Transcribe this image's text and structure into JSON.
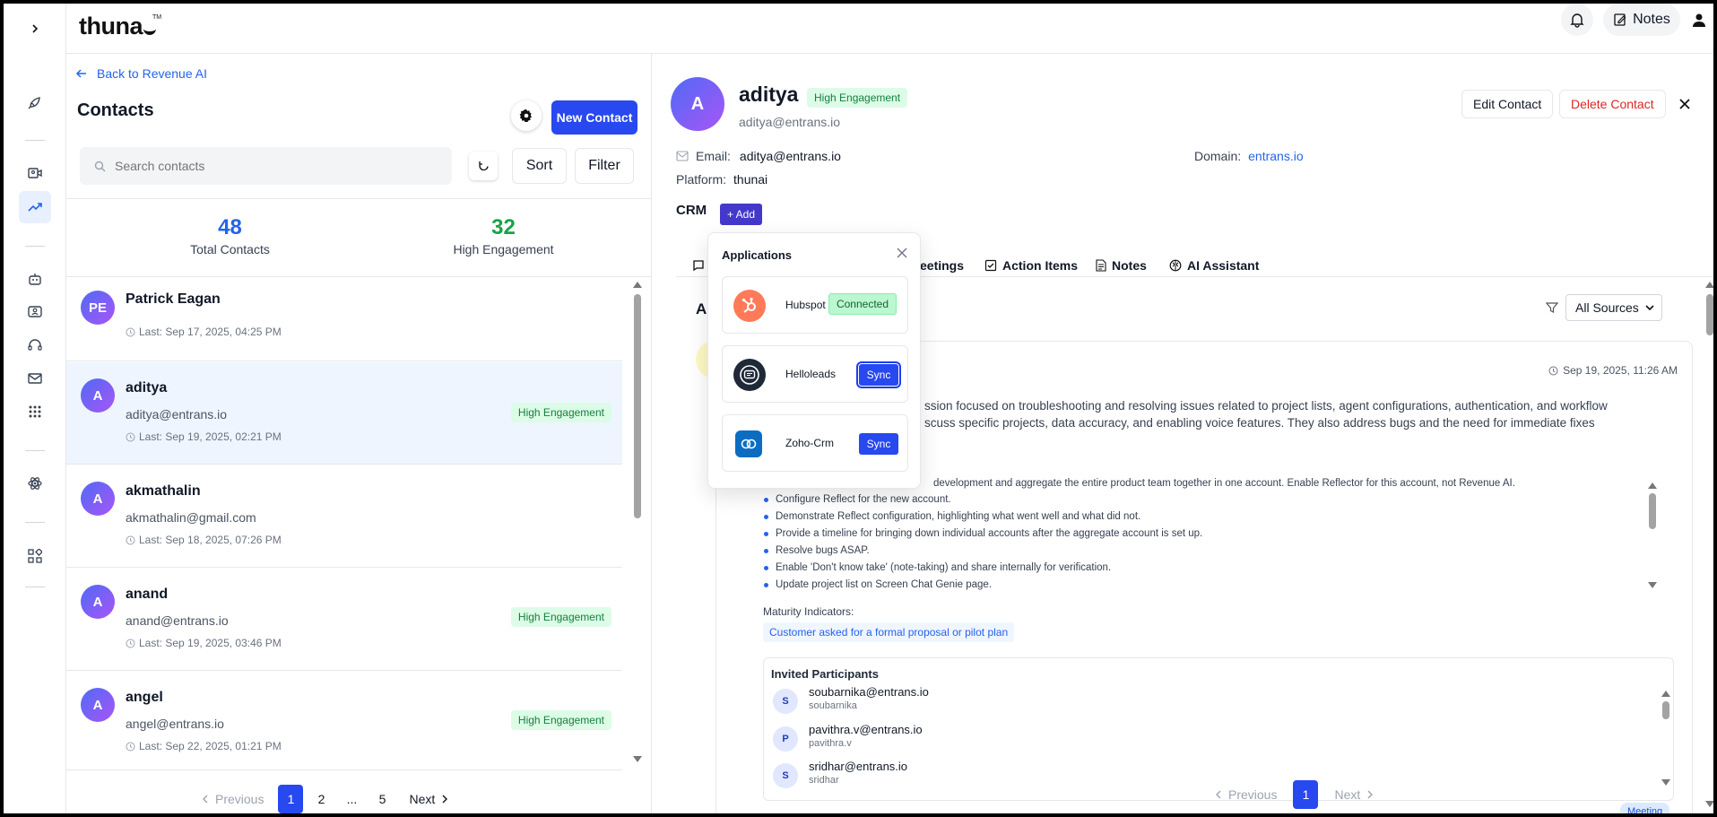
{
  "app": {
    "logo_text": "thuna",
    "logo_tm": "TM"
  },
  "topbar": {
    "notes_label": "Notes"
  },
  "left": {
    "back_label": "Back to Revenue AI",
    "title": "Contacts",
    "new_contact_label": "New Contact",
    "search_placeholder": "Search contacts",
    "sort_label": "Sort",
    "filter_label": "Filter",
    "stats": [
      {
        "value": "48",
        "label": "Total Contacts",
        "color": "#2563eb"
      },
      {
        "value": "32",
        "label": "High Engagement",
        "color": "#16a34a"
      }
    ],
    "contacts": [
      {
        "initials": "PE",
        "name": "Patrick Eagan",
        "email": "",
        "last": "Last: Sep 17, 2025, 04:25 PM",
        "badge": ""
      },
      {
        "initials": "A",
        "name": "aditya",
        "email": "aditya@entrans.io",
        "last": "Last: Sep 19, 2025, 02:21 PM",
        "badge": "High Engagement"
      },
      {
        "initials": "A",
        "name": "akmathalin",
        "email": "akmathalin@gmail.com",
        "last": "Last: Sep 18, 2025, 07:26 PM",
        "badge": ""
      },
      {
        "initials": "A",
        "name": "anand",
        "email": "anand@entrans.io",
        "last": "Last: Sep 19, 2025, 03:46 PM",
        "badge": "High Engagement"
      },
      {
        "initials": "A",
        "name": "angel",
        "email": "angel@entrans.io",
        "last": "Last: Sep 22, 2025, 01:21 PM",
        "badge": "High Engagement"
      }
    ],
    "pagination": {
      "previous": "Previous",
      "pages": [
        "1",
        "2",
        "...",
        "5"
      ],
      "next": "Next"
    }
  },
  "detail": {
    "initial": "A",
    "name": "aditya",
    "badge": "High Engagement",
    "email_sub": "aditya@entrans.io",
    "edit_label": "Edit Contact",
    "delete_label": "Delete Contact",
    "email_label": "Email:",
    "email_value": "aditya@entrans.io",
    "domain_label": "Domain:",
    "domain_value": "entrans.io",
    "platform_label": "Platform:",
    "platform_value": "thunai",
    "crm_label": "CRM",
    "add_label": "+ Add",
    "tabs": [
      "eetings",
      "Action Items",
      "Notes",
      "AI Assistant"
    ],
    "section_initial": "A",
    "sources_label": "All Sources",
    "activity": {
      "date": "Sep 19, 2025, 11:26 AM",
      "summary_line1": "ssion focused on troubleshooting and resolving issues related to project lists, agent configurations, authentication, and workflow",
      "summary_line2": "scuss specific projects, data accuracy, and enabling voice features. They also address bugs and the need for immediate fixes",
      "action_items": [
        "development and aggregate the entire product team together in one account. Enable Reflector for this account, not Revenue AI.",
        "Configure Reflect for the new account.",
        "Demonstrate Reflect configuration, highlighting what went well and what did not.",
        "Provide a timeline for bringing down individual accounts after the aggregate account is set up.",
        "Resolve bugs ASAP.",
        "Enable 'Don't know take' (note-taking) and share internally for verification.",
        "Update project list on Screen Chat Genie page."
      ],
      "maturity_label": "Maturity Indicators:",
      "maturity_tag": "Customer asked for a formal proposal or pilot plan",
      "participants_label": "Invited Participants",
      "participants": [
        {
          "initial": "S",
          "email": "soubarnika@entrans.io",
          "name": "soubarnika"
        },
        {
          "initial": "P",
          "email": "pavithra.v@entrans.io",
          "name": "pavithra.v"
        },
        {
          "initial": "S",
          "email": "sridhar@entrans.io",
          "name": "sridhar"
        }
      ],
      "meeting_tag": "Meeting"
    },
    "pagination": {
      "previous": "Previous",
      "page": "1",
      "next": "Next"
    }
  },
  "popover": {
    "title": "Applications",
    "apps": [
      {
        "name": "Hubspot",
        "action": "Connected"
      },
      {
        "name": "Helloleads",
        "action": "Sync"
      },
      {
        "name": "Zoho-Crm",
        "action": "Sync"
      }
    ]
  }
}
